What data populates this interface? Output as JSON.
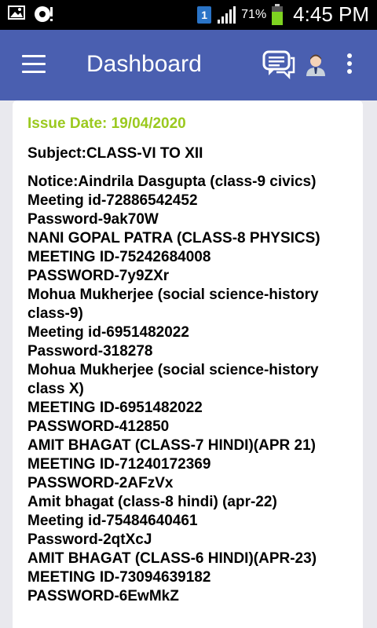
{
  "status_bar": {
    "sim_label": "1",
    "battery": "71%",
    "time": "4:45 PM"
  },
  "app_bar": {
    "title": "Dashboard"
  },
  "notice": {
    "issue_date": "Issue Date: 19/04/2020",
    "subject": "Subject:CLASS-VI TO XII",
    "lines": [
      "Notice:Aindrila Dasgupta (class-9 civics)",
      "Meeting id-72886542452",
      "Password-9ak70W",
      "NANI GOPAL PATRA (CLASS-8 PHYSICS)",
      "MEETING ID-75242684008",
      "PASSWORD-7y9ZXr",
      "Mohua Mukherjee (social science-history",
      "class-9)",
      "Meeting id-6951482022",
      "Password-318278",
      "Mohua Mukherjee (social science-history",
      "class X)",
      "MEETING ID-6951482022",
      "PASSWORD-412850",
      "AMIT BHAGAT (CLASS-7 HINDI)(APR 21)",
      "MEETING ID-71240172369",
      "PASSWORD-2AFzVx",
      "Amit bhagat (class-8 hindi) (apr-22)",
      "Meeting id-75484640461",
      "Password-2qtXcJ",
      "AMIT BHAGAT (CLASS-6 HINDI)(APR-23)",
      "MEETING ID-73094639182",
      "PASSWORD-6EwMkZ"
    ]
  }
}
